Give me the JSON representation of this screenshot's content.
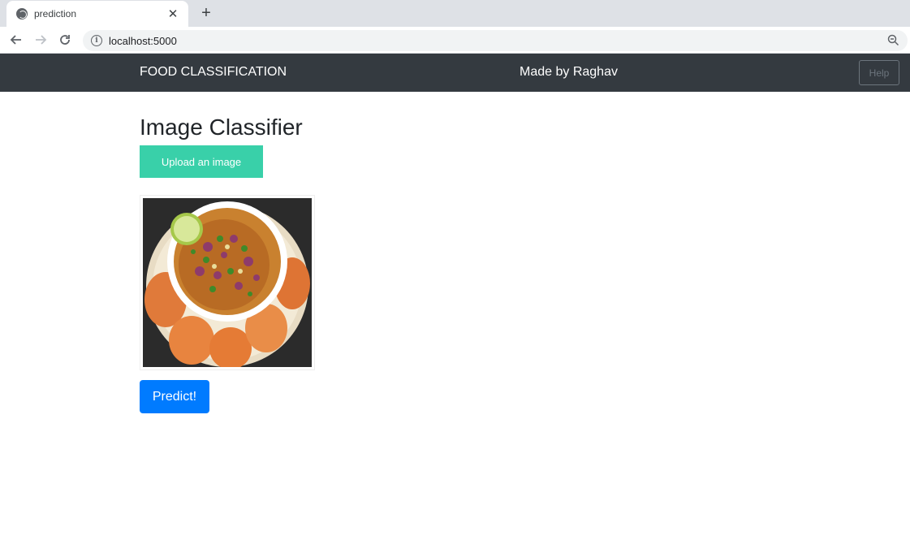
{
  "browser": {
    "tab_title": "prediction",
    "url": "localhost:5000",
    "icons": {
      "tab": "globe-icon",
      "close": "close-icon",
      "new_tab": "plus-icon",
      "back": "back-arrow-icon",
      "forward": "forward-arrow-icon",
      "reload": "reload-icon",
      "info": "info-icon",
      "zoom": "zoom-out-icon"
    }
  },
  "navbar": {
    "brand": "FOOD CLASSIFICATION",
    "center_text": "Made by Raghav",
    "help_label": "Help",
    "background": "#343a40"
  },
  "main": {
    "title": "Image Classifier",
    "upload_label": "Upload an image",
    "predict_label": "Predict!",
    "colors": {
      "upload": "#39d0a9",
      "predict": "#007bff"
    }
  }
}
